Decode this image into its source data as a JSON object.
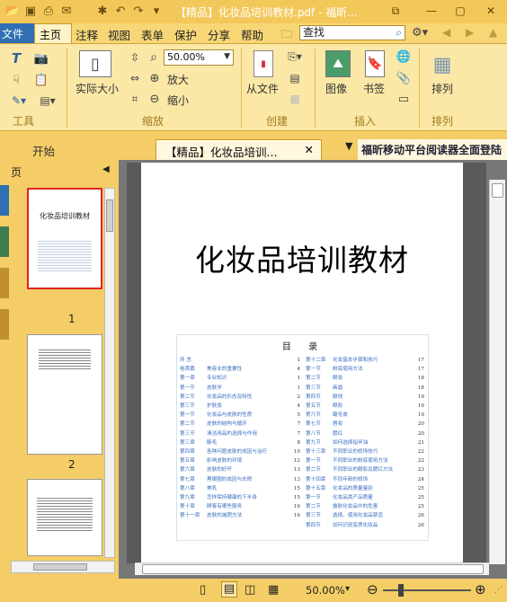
{
  "window": {
    "title": "【精品】化妆品培训教材.pdf - 福昕...",
    "controls": [
      "minimize",
      "maximize",
      "close"
    ]
  },
  "menu": {
    "items": [
      "文件",
      "主页",
      "注释",
      "视图",
      "表单",
      "保护",
      "分享",
      "帮助"
    ],
    "search_placeholder": "查找"
  },
  "ribbon": {
    "zoom_value": "50.00%",
    "buttons": {
      "actual_size": "实际大小",
      "zoom_in": "放大",
      "zoom_out": "缩小",
      "from_file": "从文件",
      "image": "图像",
      "bookmark": "书签",
      "arrange": "排列"
    },
    "groups": [
      "工具",
      "缩放",
      "创建",
      "插入",
      "排列"
    ]
  },
  "tabs": {
    "start": "开始",
    "doc": "【精品】化妆品培训...",
    "ad": "福昕移动平台阅读器全面登陆"
  },
  "panel": {
    "title": "页",
    "thumb1_title": "化妆品培训教材",
    "page_numbers": [
      "1",
      "2"
    ]
  },
  "document": {
    "title": "化妆品培训教材",
    "toc_title": "目 录",
    "toc_left": [
      {
        "c": "序 言",
        "t": "",
        "p": "1"
      },
      {
        "c": "卷首篇",
        "t": "美容业的重要性",
        "p": "4"
      },
      {
        "c": "第一章",
        "t": "专业知识",
        "p": "1"
      },
      {
        "c": "第一节",
        "t": "皮肤学",
        "p": "1"
      },
      {
        "c": "第二节",
        "t": "化妆品的形态及特性",
        "p": "2"
      },
      {
        "c": "第三节",
        "t": "护肤类",
        "p": "4"
      },
      {
        "c": "第一节",
        "t": "化妆品与皮肤的性质",
        "p": "5"
      },
      {
        "c": "第二节",
        "t": "皮肤的结构与循环",
        "p": "7"
      },
      {
        "c": "第三节",
        "t": "清洁用品的选择与作用",
        "p": "7"
      },
      {
        "c": "第三章",
        "t": "腋毛",
        "p": "8"
      },
      {
        "c": "第四章",
        "t": "各种问题皮肤的成因与治疗",
        "p": "10"
      },
      {
        "c": "第五章",
        "t": "影响皮肤的环境",
        "p": "12"
      },
      {
        "c": "第六章",
        "t": "皮肤的好坏",
        "p": "13"
      },
      {
        "c": "第七章",
        "t": "黑眼圈的成因与去除",
        "p": "13"
      },
      {
        "c": "第八章",
        "t": "美乳",
        "p": "15"
      },
      {
        "c": "第九章",
        "t": "怎样保持健康的下半身",
        "p": "15"
      },
      {
        "c": "第十章",
        "t": "顾客有哪些服务",
        "p": "16"
      },
      {
        "c": "第十一章",
        "t": "皮肤的减肥方法",
        "p": "16"
      }
    ],
    "toc_right": [
      {
        "c": "第十二章",
        "t": "化妆基本步骤和技巧",
        "p": "17"
      },
      {
        "c": "第一节",
        "t": "粉底使用方法",
        "p": "17"
      },
      {
        "c": "第二节",
        "t": "眼妆",
        "p": "18"
      },
      {
        "c": "第三节",
        "t": "画眉",
        "p": "18"
      },
      {
        "c": "第四节",
        "t": "眼线",
        "p": "19"
      },
      {
        "c": "第五节",
        "t": "眼影",
        "p": "19"
      },
      {
        "c": "第六节",
        "t": "睫毛膏",
        "p": "19"
      },
      {
        "c": "第七节",
        "t": "唇妆",
        "p": "20"
      },
      {
        "c": "第八节",
        "t": "腮红",
        "p": "20"
      },
      {
        "c": "第九节",
        "t": "如何选择指甲油",
        "p": "21"
      },
      {
        "c": "第十三章",
        "t": "不同职业的修饰技巧",
        "p": "22"
      },
      {
        "c": "第一节",
        "t": "不同职业的粉底使用方法",
        "p": "22"
      },
      {
        "c": "第二节",
        "t": "不同职业的眼影及腮红方法",
        "p": "23"
      },
      {
        "c": "第十四章",
        "t": "不同年龄的修饰",
        "p": "24"
      },
      {
        "c": "第十五章",
        "t": "化妆品的质量鉴别",
        "p": "25"
      },
      {
        "c": "第一节",
        "t": "化妆品类产品质量",
        "p": "25"
      },
      {
        "c": "第二节",
        "t": "露肤化妆品中的危害",
        "p": "25"
      },
      {
        "c": "第三节",
        "t": "选择、使用化妆品禁忌",
        "p": "26"
      },
      {
        "c": "第四节",
        "t": "如何识别变质化妆品",
        "p": "26"
      }
    ]
  },
  "status": {
    "zoom": "50.00%"
  }
}
